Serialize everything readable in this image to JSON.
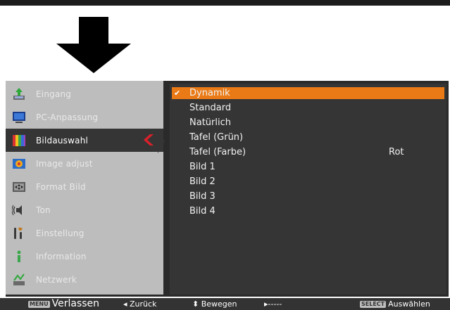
{
  "menu": {
    "items": [
      {
        "label": "Eingang",
        "icon": "input-icon"
      },
      {
        "label": "PC-Anpassung",
        "icon": "pc-adjust-icon"
      },
      {
        "label": "Bildauswahl",
        "icon": "image-select-icon"
      },
      {
        "label": "Image adjust",
        "icon": "image-adjust-icon"
      },
      {
        "label": "Format Bild",
        "icon": "screen-format-icon"
      },
      {
        "label": "Ton",
        "icon": "speaker-icon"
      },
      {
        "label": "Einstellung",
        "icon": "settings-icon"
      },
      {
        "label": "Information",
        "icon": "info-icon"
      },
      {
        "label": "Netzwerk",
        "icon": "network-icon"
      }
    ],
    "active_index": 2
  },
  "options": {
    "items": [
      {
        "label": "Dynamik",
        "selected": true
      },
      {
        "label": "Standard"
      },
      {
        "label": "Natürlich"
      },
      {
        "label": "Tafel (Grün)"
      },
      {
        "label": "Tafel (Farbe)",
        "value": "Rot"
      },
      {
        "label": "Bild 1"
      },
      {
        "label": "Bild 2"
      },
      {
        "label": "Bild 3"
      },
      {
        "label": "Bild 4"
      }
    ]
  },
  "footer": {
    "menu_badge": "MENU",
    "exit_label": "Verlassen",
    "back_label": "◂ Zurück",
    "move_label": "⬍ Bewegen",
    "next_label": "▸-----",
    "select_badge": "SELECT",
    "select_label": "Auswählen"
  },
  "colors": {
    "highlight": "#e97a16",
    "active_chevron": "#e0202a",
    "panel_dark": "#353535",
    "panel_light": "#bdbdbd"
  }
}
